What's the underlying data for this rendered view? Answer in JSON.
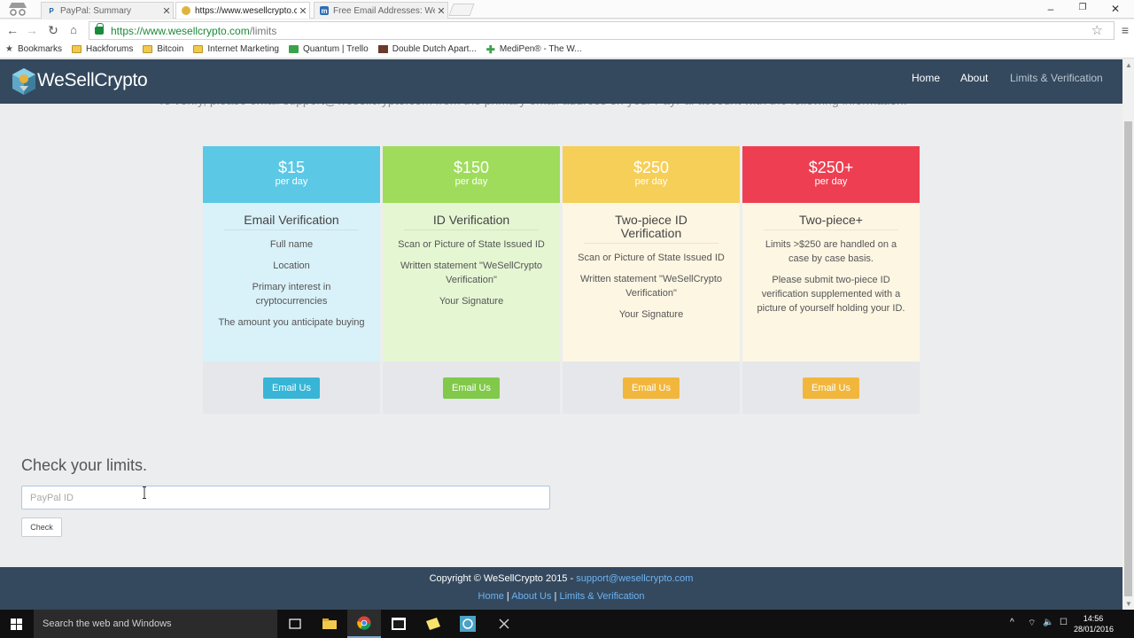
{
  "browser": {
    "tabs": [
      {
        "title": "PayPal: Summary",
        "favicon": "paypal-icon"
      },
      {
        "title": "https://www.wesellcrypto.c",
        "favicon": "wesellcrypto-icon"
      },
      {
        "title": "Free Email Addresses: Wel",
        "favicon": "mail-site-icon"
      }
    ],
    "url_host": "https://www.wesellcrypto.com",
    "url_path": "/limits",
    "bookmarks": [
      "Bookmarks",
      "Hackforums",
      "Bitcoin",
      "Internet Marketing",
      "Quantum | Trello",
      "Double Dutch Apart...",
      "MediPen® - The W..."
    ]
  },
  "site": {
    "brand": "WeSellCrypto",
    "nav": [
      "Home",
      "About",
      "Limits & Verification"
    ],
    "clipped_text": "To verify, please email support@wesellcrypto.com from the primary email address on your PayPal account with the following information:"
  },
  "plans": [
    {
      "price": "$15",
      "per": "per day",
      "title": "Email Verification",
      "items": [
        "Full name",
        "Location",
        "Primary interest in cryptocurrencies",
        "The amount you anticipate buying"
      ],
      "button": "Email Us",
      "color": "#5bc8e6",
      "bg": "#d9f1f8",
      "btn": "#38b5d6"
    },
    {
      "price": "$150",
      "per": "per day",
      "title": "ID Verification",
      "items": [
        "Scan or Picture of State Issued ID",
        "Written statement \"WeSellCrypto Verification\"",
        "Your Signature"
      ],
      "button": "Email Us",
      "color": "#9fdc5c",
      "bg": "#e5f6d3",
      "btn": "#80c94a"
    },
    {
      "price": "$250",
      "per": "per day",
      "title": "Two-piece ID Verification",
      "items": [
        "Scan or Picture of State Issued ID",
        "Written statement \"WeSellCrypto Verification\"",
        "Your Signature"
      ],
      "button": "Email Us",
      "color": "#f6cf58",
      "bg": "#fdf6e3",
      "btn": "#f1b73c"
    },
    {
      "price": "$250+",
      "per": "per day",
      "title": "Two-piece+",
      "items": [
        "Limits >$250 are handled on a case by case basis.",
        "Please submit two-piece ID verification supplemented with a picture of yourself holding your ID."
      ],
      "button": "Email Us",
      "color": "#ee3f52",
      "bg": "#fdf6e3",
      "btn": "#f1b73c"
    }
  ],
  "check": {
    "title": "Check your limits.",
    "placeholder": "PayPal ID",
    "button": "Check"
  },
  "footer": {
    "copyright": "Copyright © WeSellCrypto 2015 -",
    "email": "support@wesellcrypto.com",
    "links": [
      "Home",
      "About Us",
      "Limits & Verification"
    ]
  },
  "taskbar": {
    "search_placeholder": "Search the web and Windows",
    "time": "14:56",
    "date": "28/01/2016"
  }
}
